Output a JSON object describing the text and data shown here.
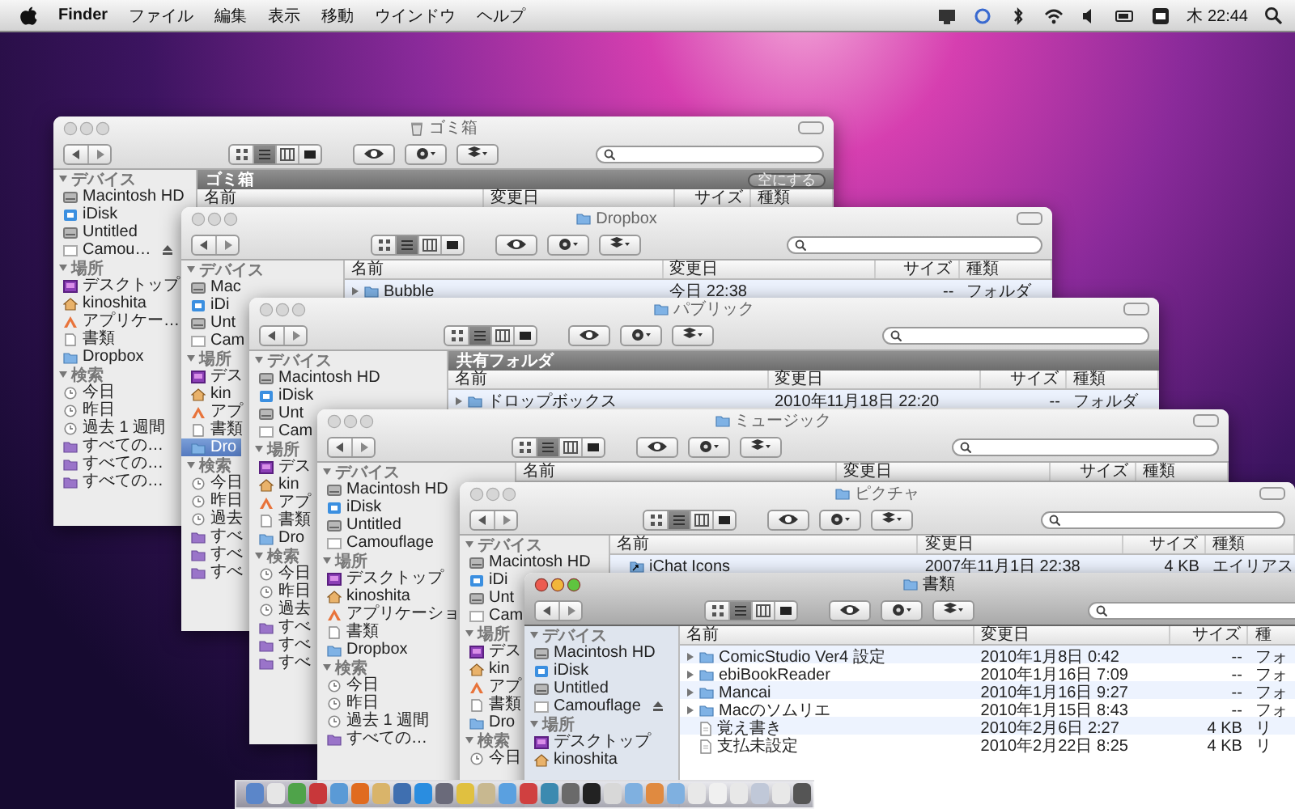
{
  "menubar": {
    "app": "Finder",
    "menus": [
      "ファイル",
      "編集",
      "表示",
      "移動",
      "ウインドウ",
      "ヘルプ"
    ],
    "clock": "木 22:44"
  },
  "windows": [
    {
      "title": "ゴミ箱",
      "active": false,
      "view_buttons": [
        {
          "selected": false
        },
        {
          "selected": true
        },
        {
          "selected": false
        },
        {
          "selected": false
        }
      ],
      "sidebar": [
        {
          "heading": "デバイス",
          "items": [
            {
              "label": "Macintosh HD",
              "kind": "disk",
              "selected": false
            },
            {
              "label": "iDisk",
              "kind": "idisk",
              "selected": false
            },
            {
              "label": "Untitled",
              "kind": "disk",
              "selected": false
            },
            {
              "label": "Camou…",
              "kind": "removable",
              "selected": false,
              "eject": true
            }
          ]
        },
        {
          "heading": "場所",
          "items": [
            {
              "label": "デスクトップ",
              "kind": "desktop",
              "selected": false
            },
            {
              "label": "kinoshita",
              "kind": "home",
              "selected": false
            },
            {
              "label": "アプリケー…",
              "kind": "apps",
              "selected": false
            },
            {
              "label": "書類",
              "kind": "docs",
              "selected": false
            },
            {
              "label": "Dropbox",
              "kind": "folder",
              "selected": false
            }
          ]
        },
        {
          "heading": "検索",
          "items": [
            {
              "label": "今日",
              "kind": "clock",
              "selected": false
            },
            {
              "label": "昨日",
              "kind": "clock",
              "selected": false
            },
            {
              "label": "過去 1 週間",
              "kind": "clock",
              "selected": false
            },
            {
              "label": "すべての…",
              "kind": "smart",
              "selected": false
            },
            {
              "label": "すべての…",
              "kind": "smart",
              "selected": false
            },
            {
              "label": "すべての…",
              "kind": "smart",
              "selected": false
            }
          ]
        }
      ],
      "banner": {
        "label": "ゴミ箱",
        "action": "空にする"
      },
      "columns": [
        "名前",
        "変更日",
        "サイズ",
        "種類"
      ]
    },
    {
      "title": "Dropbox",
      "active": false,
      "view_buttons": [
        {
          "selected": false
        },
        {
          "selected": true
        },
        {
          "selected": false
        },
        {
          "selected": false
        }
      ],
      "sidebar": [
        {
          "heading": "デバイス",
          "items": [
            {
              "label": "Mac",
              "kind": "disk",
              "selected": false
            },
            {
              "label": "iDi",
              "kind": "idisk",
              "selected": false
            },
            {
              "label": "Unt",
              "kind": "disk",
              "selected": false
            },
            {
              "label": "Cam",
              "kind": "removable",
              "selected": false
            }
          ]
        },
        {
          "heading": "場所",
          "items": [
            {
              "label": "デス",
              "kind": "desktop",
              "selected": false
            },
            {
              "label": "kin",
              "kind": "home",
              "selected": false
            },
            {
              "label": "アプ",
              "kind": "apps",
              "selected": false
            },
            {
              "label": "書類",
              "kind": "docs",
              "selected": false
            },
            {
              "label": "Dro",
              "kind": "folder",
              "selected": true
            }
          ]
        },
        {
          "heading": "検索",
          "items": [
            {
              "label": "今日",
              "kind": "clock",
              "selected": false
            },
            {
              "label": "昨日",
              "kind": "clock",
              "selected": false
            },
            {
              "label": "過去",
              "kind": "clock",
              "selected": false
            },
            {
              "label": "すべ",
              "kind": "smart",
              "selected": false
            },
            {
              "label": "すべ",
              "kind": "smart",
              "selected": false
            },
            {
              "label": "すべ",
              "kind": "smart",
              "selected": false
            }
          ]
        }
      ],
      "columns": [
        "名前",
        "変更日",
        "サイズ",
        "種類"
      ],
      "rows": [
        {
          "kind": "folder",
          "name": "Bubble",
          "modified": "今日 22:38",
          "size": "--",
          "type": "フォルダ"
        }
      ]
    },
    {
      "title": "パブリック",
      "active": false,
      "view_buttons": [
        {
          "selected": false
        },
        {
          "selected": true
        },
        {
          "selected": false
        },
        {
          "selected": false
        }
      ],
      "sidebar": [
        {
          "heading": "デバイス",
          "items": [
            {
              "label": "Macintosh HD",
              "kind": "disk",
              "selected": false
            },
            {
              "label": "iDisk",
              "kind": "idisk",
              "selected": false
            },
            {
              "label": "Unt",
              "kind": "disk",
              "selected": false
            },
            {
              "label": "Cam",
              "kind": "removable",
              "selected": false
            }
          ]
        },
        {
          "heading": "場所",
          "items": [
            {
              "label": "デス",
              "kind": "desktop",
              "selected": false
            },
            {
              "label": "kin",
              "kind": "home",
              "selected": false
            },
            {
              "label": "アプ",
              "kind": "apps",
              "selected": false
            },
            {
              "label": "書類",
              "kind": "docs",
              "selected": false
            },
            {
              "label": "Dro",
              "kind": "folder",
              "selected": false
            }
          ]
        },
        {
          "heading": "検索",
          "items": [
            {
              "label": "今日",
              "kind": "clock",
              "selected": false
            },
            {
              "label": "昨日",
              "kind": "clock",
              "selected": false
            },
            {
              "label": "過去",
              "kind": "clock",
              "selected": false
            },
            {
              "label": "すべ",
              "kind": "smart",
              "selected": false
            },
            {
              "label": "すべ",
              "kind": "smart",
              "selected": false
            },
            {
              "label": "すべ",
              "kind": "smart",
              "selected": false
            }
          ]
        }
      ],
      "banner": {
        "label": "共有フォルダ"
      },
      "columns": [
        "名前",
        "変更日",
        "サイズ",
        "種類"
      ],
      "rows": [
        {
          "kind": "folder",
          "name": "ドロップボックス",
          "modified": "2010年11月18日 22:20",
          "size": "--",
          "type": "フォルダ"
        }
      ]
    },
    {
      "title": "ミュージック",
      "active": false,
      "view_buttons": [
        {
          "selected": false
        },
        {
          "selected": true
        },
        {
          "selected": false
        },
        {
          "selected": false
        }
      ],
      "sidebar": [
        {
          "heading": "デバイス",
          "items": [
            {
              "label": "Macintosh HD",
              "kind": "disk",
              "selected": false
            },
            {
              "label": "iDisk",
              "kind": "idisk",
              "selected": false
            },
            {
              "label": "Untitled",
              "kind": "disk",
              "selected": false
            },
            {
              "label": "Camouflage",
              "kind": "removable",
              "selected": false
            }
          ]
        },
        {
          "heading": "場所",
          "items": [
            {
              "label": "デスクトップ",
              "kind": "desktop",
              "selected": false
            },
            {
              "label": "kinoshita",
              "kind": "home",
              "selected": false
            },
            {
              "label": "アプリケーショ",
              "kind": "apps",
              "selected": false
            },
            {
              "label": "書類",
              "kind": "docs",
              "selected": false
            },
            {
              "label": "Dropbox",
              "kind": "folder",
              "selected": false
            }
          ]
        },
        {
          "heading": "検索",
          "items": [
            {
              "label": "今日",
              "kind": "clock",
              "selected": false
            },
            {
              "label": "昨日",
              "kind": "clock",
              "selected": false
            },
            {
              "label": "過去 1 週間",
              "kind": "clock",
              "selected": false
            },
            {
              "label": "すべての…",
              "kind": "smart",
              "selected": false
            }
          ]
        }
      ],
      "columns": [
        "名前",
        "変更日",
        "サイズ",
        "種類"
      ]
    },
    {
      "title": "ピクチャ",
      "active": false,
      "view_buttons": [
        {
          "selected": false
        },
        {
          "selected": true
        },
        {
          "selected": false
        },
        {
          "selected": false
        }
      ],
      "sidebar": [
        {
          "heading": "デバイス",
          "items": [
            {
              "label": "Macintosh HD",
              "kind": "disk",
              "selected": false
            },
            {
              "label": "iDi",
              "kind": "idisk",
              "selected": false
            },
            {
              "label": "Unt",
              "kind": "disk",
              "selected": false
            },
            {
              "label": "Cam",
              "kind": "removable",
              "selected": false
            }
          ]
        },
        {
          "heading": "場所",
          "items": [
            {
              "label": "デス",
              "kind": "desktop",
              "selected": false
            },
            {
              "label": "kin",
              "kind": "home",
              "selected": false
            },
            {
              "label": "アプ",
              "kind": "apps",
              "selected": false
            },
            {
              "label": "書類",
              "kind": "docs",
              "selected": false
            },
            {
              "label": "Dro",
              "kind": "folder",
              "selected": false
            }
          ]
        },
        {
          "heading": "検索",
          "items": [
            {
              "label": "今日",
              "kind": "clock",
              "selected": false
            }
          ]
        }
      ],
      "columns": [
        "名前",
        "変更日",
        "サイズ",
        "種類"
      ],
      "rows": [
        {
          "kind": "alias",
          "name": "iChat Icons",
          "modified": "2007年11月1日 22:38",
          "size": "4 KB",
          "type": "エイリアス"
        }
      ]
    },
    {
      "title": "書類",
      "active": true,
      "view_buttons": [
        {
          "selected": false
        },
        {
          "selected": true
        },
        {
          "selected": false
        },
        {
          "selected": false
        }
      ],
      "sidebar": [
        {
          "heading": "デバイス",
          "items": [
            {
              "label": "Macintosh HD",
              "kind": "disk",
              "selected": false
            },
            {
              "label": "iDisk",
              "kind": "idisk",
              "selected": false
            },
            {
              "label": "Untitled",
              "kind": "disk",
              "selected": false
            },
            {
              "label": "Camouflage",
              "kind": "removable",
              "selected": false,
              "eject": true
            }
          ]
        },
        {
          "heading": "場所",
          "items": [
            {
              "label": "デスクトップ",
              "kind": "desktop",
              "selected": false
            },
            {
              "label": "kinoshita",
              "kind": "home",
              "selected": false
            }
          ]
        }
      ],
      "columns": [
        "名前",
        "変更日",
        "サイズ",
        "種"
      ],
      "rows": [
        {
          "kind": "folder",
          "name": "ComicStudio Ver4 設定",
          "modified": "2010年1月8日 0:42",
          "size": "--",
          "type": "フォ"
        },
        {
          "kind": "folder",
          "name": "ebiBookReader",
          "modified": "2010年1月16日 7:09",
          "size": "--",
          "type": "フォ"
        },
        {
          "kind": "folder",
          "name": "Mancai",
          "modified": "2010年1月16日 9:27",
          "size": "--",
          "type": "フォ"
        },
        {
          "kind": "folder",
          "name": "Macのソムリエ",
          "modified": "2010年1月15日 8:43",
          "size": "--",
          "type": "フォ"
        },
        {
          "kind": "file",
          "name": "覚え書き",
          "modified": "2010年2月6日 2:27",
          "size": "4 KB",
          "type": "リ"
        },
        {
          "kind": "file",
          "name": "支払未設定",
          "modified": "2010年2月22日 8:25",
          "size": "4 KB",
          "type": "リ"
        }
      ]
    }
  ]
}
